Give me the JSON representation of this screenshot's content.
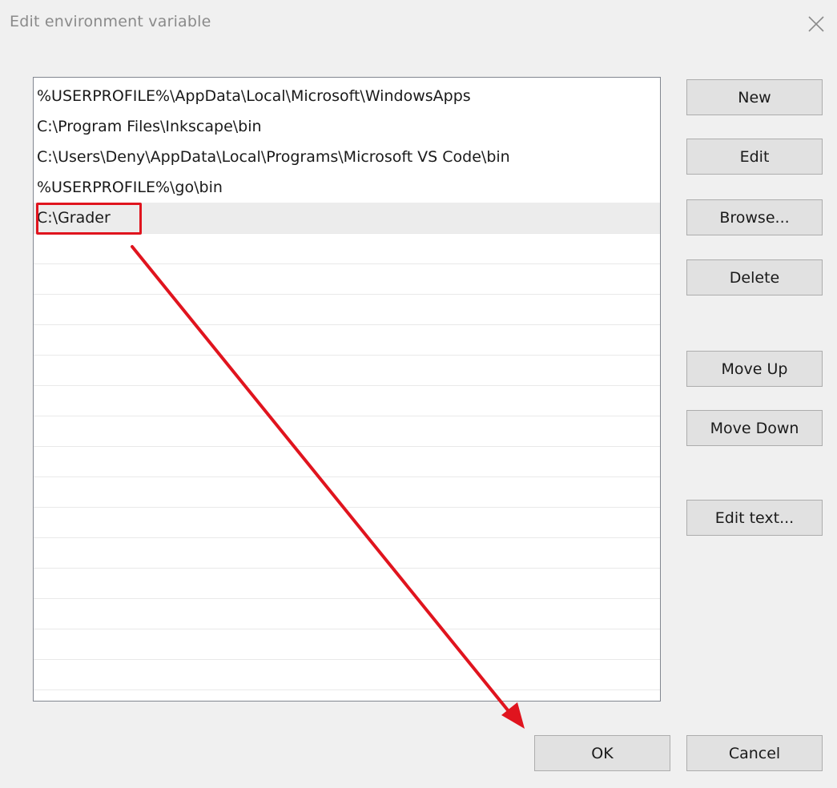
{
  "window": {
    "title": "Edit environment variable",
    "close_icon": "close-icon"
  },
  "list": {
    "items": [
      "%USERPROFILE%\\AppData\\Local\\Microsoft\\WindowsApps",
      "C:\\Program Files\\Inkscape\\bin",
      "C:\\Users\\Deny\\AppData\\Local\\Programs\\Microsoft VS Code\\bin",
      "%USERPROFILE%\\go\\bin",
      "C:\\Grader"
    ],
    "selected_index": 4
  },
  "buttons": {
    "new": "New",
    "edit": "Edit",
    "browse": "Browse...",
    "delete": "Delete",
    "move_up": "Move Up",
    "move_down": "Move Down",
    "edit_text": "Edit text...",
    "ok": "OK",
    "cancel": "Cancel"
  },
  "colors": {
    "annotation": "#e0141e",
    "selection": "#ececec",
    "background": "#f0f0f0"
  }
}
